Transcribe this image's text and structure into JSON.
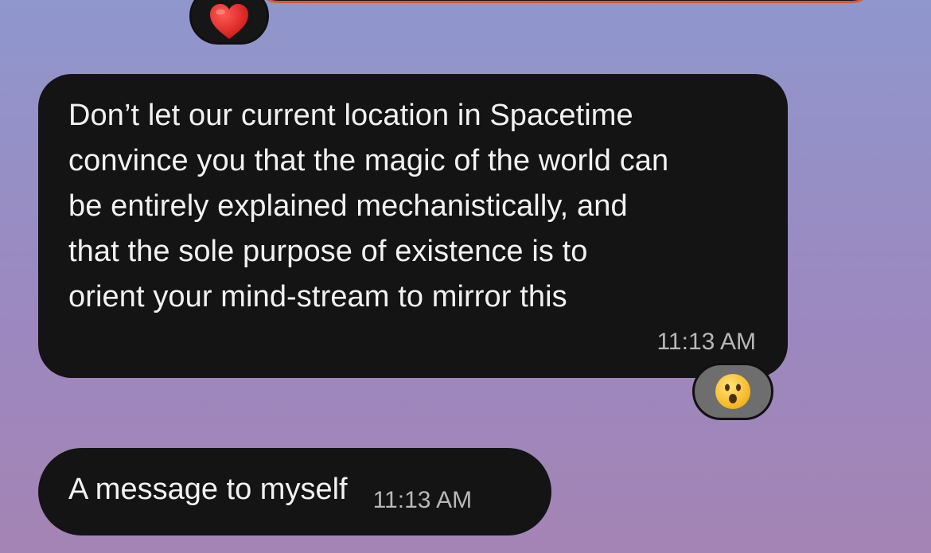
{
  "messages": [
    {
      "text": "Don’t let our current location in Spacetime\nconvince you that the magic of the world can\nbe entirely explained mechanistically, and\nthat the sole purpose of existence is to\norient your mind-stream to mirror this",
      "time": "11:13 AM",
      "reaction": "surprised-face-icon"
    },
    {
      "text": "A message to myself",
      "time": "11:13 AM"
    }
  ],
  "previous_reaction": "heart-icon",
  "colors": {
    "bubble": "#141414",
    "text": "#f2f2f2",
    "timestamp": "#b8b8b8",
    "reaction_bg_dark": "#161616",
    "reaction_bg_gray": "#6e6e6e",
    "accent": "#d8583a"
  }
}
